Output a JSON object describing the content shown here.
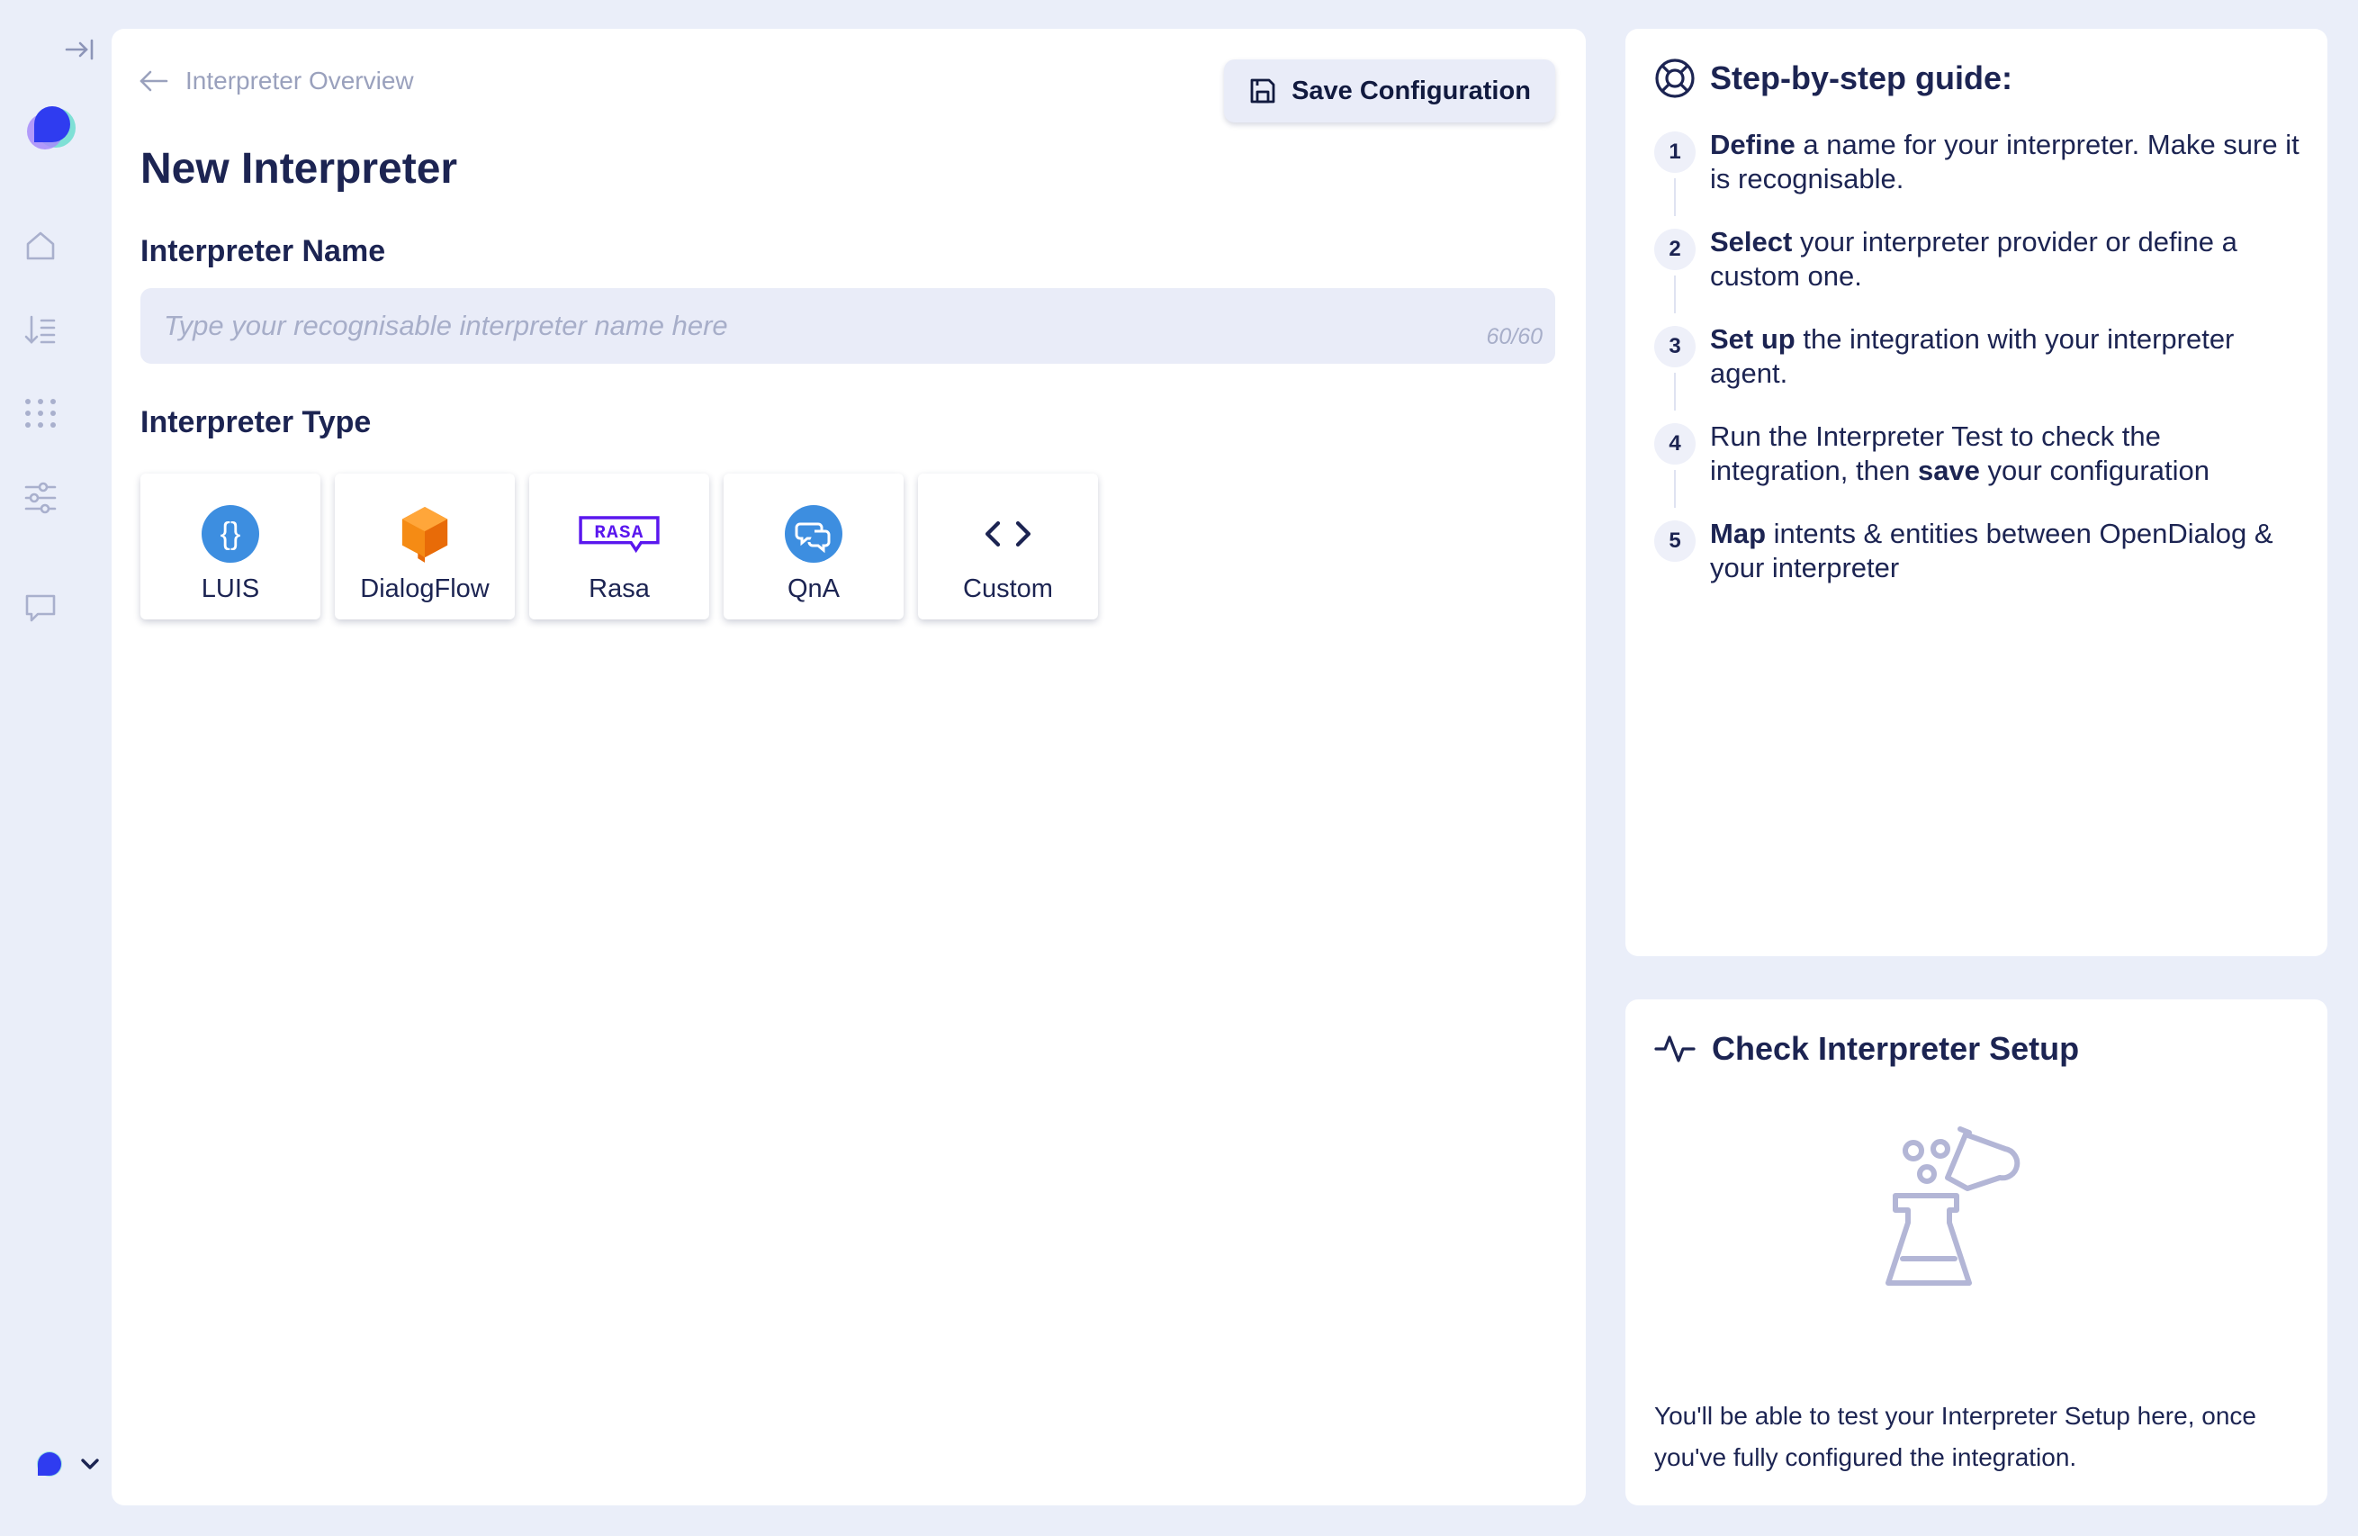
{
  "breadcrumb": {
    "back_label": "Interpreter Overview"
  },
  "toolbar": {
    "save_label": "Save Configuration"
  },
  "page": {
    "title": "New Interpreter"
  },
  "name_section": {
    "label": "Interpreter Name",
    "placeholder": "Type your recognisable interpreter name here",
    "value": "",
    "char_count": "60/60"
  },
  "type_section": {
    "label": "Interpreter Type",
    "options": [
      {
        "label": "LUIS",
        "icon": "luis-logo",
        "color": "#3d8ee0"
      },
      {
        "label": "DialogFlow",
        "icon": "dialogflow-logo",
        "color": "#f07a0c"
      },
      {
        "label": "Rasa",
        "icon": "rasa-logo",
        "color": "#5a17ee"
      },
      {
        "label": "QnA",
        "icon": "qna-logo",
        "color": "#3d8ee0"
      },
      {
        "label": "Custom",
        "icon": "code-icon",
        "color": "#1c2452"
      }
    ]
  },
  "guide": {
    "title": "Step-by-step guide:",
    "steps": [
      {
        "num": "1",
        "bold": "Define",
        "text": " a name for your interpreter. Make sure it is recognisable."
      },
      {
        "num": "2",
        "bold": "Select",
        "text": " your interpreter provider or define a custom one."
      },
      {
        "num": "3",
        "bold": "Set up",
        "text": " the integration with your interpreter agent."
      },
      {
        "num": "4",
        "pre": "Run the Interpreter Test to check the integration, then ",
        "bold": "save",
        "text": " your configuration"
      },
      {
        "num": "5",
        "bold": "Map",
        "text": " intents & entities between OpenDialog & your interpreter"
      }
    ]
  },
  "check": {
    "title": "Check Interpreter Setup",
    "message": "You'll be able to test your Interpreter Setup here, once you've fully configured the integration."
  },
  "sidebar": {
    "icons": [
      "collapse-icon",
      "app-logo",
      "home-icon",
      "scenarios-icon",
      "apps-grid-icon",
      "settings-sliders-icon",
      "chat-icon",
      "account-avatar",
      "chevron-down-icon"
    ]
  },
  "colors": {
    "background": "#eaeef9",
    "card": "#ffffff",
    "text": "#1c2452",
    "muted": "#a7aec9",
    "input_bg": "#e9ecf8"
  }
}
